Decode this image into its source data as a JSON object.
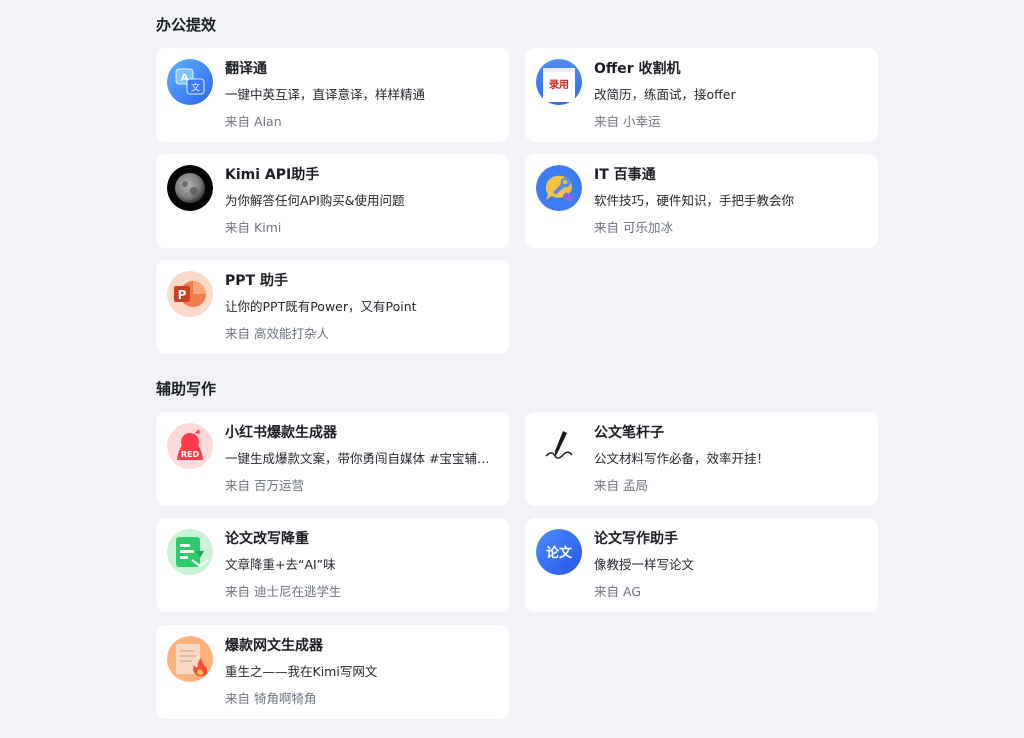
{
  "sections": [
    {
      "title": "办公提效",
      "cards": [
        {
          "name": "翻译通",
          "desc": "一键中英互译，直译意译，样样精通",
          "author": "Alan",
          "icon": "translate-icon"
        },
        {
          "name": "Offer 收割机",
          "desc": "改简历，练面试，接offer",
          "author": "小幸运",
          "icon": "offer-stamp-icon"
        },
        {
          "name": "Kimi API助手",
          "desc": "为你解答任何API购买&使用问题",
          "author": "Kimi",
          "icon": "moon-icon"
        },
        {
          "name": "IT 百事通",
          "desc": "软件技巧，硬件知识，手把手教会你",
          "author": "可乐加冰",
          "icon": "wrench-chat-icon"
        },
        {
          "name": "PPT 助手",
          "desc": "让你的PPT既有Power，又有Point",
          "author": "高效能打杂人",
          "icon": "powerpoint-icon"
        }
      ]
    },
    {
      "title": "辅助写作",
      "cards": [
        {
          "name": "小红书爆款生成器",
          "desc": "一键生成爆款文案，带你勇闯自媒体 #宝宝辅食 #敏感肌护肤",
          "author": "百万运营",
          "icon": "red-book-icon"
        },
        {
          "name": "公文笔杆子",
          "desc": "公文材料写作必备，效率开挂！",
          "author": "孟局",
          "icon": "pen-nib-icon"
        },
        {
          "name": "论文改写降重",
          "desc": "文章降重+去“AI”味",
          "author": "迪士尼在逃学生",
          "icon": "document-rewrite-icon"
        },
        {
          "name": "论文写作助手",
          "desc": "像教授一样写论文",
          "author": "AG",
          "icon": "thesis-icon"
        },
        {
          "name": "爆款网文生成器",
          "desc": "重生之——我在Kimi写网文",
          "author": "犄角啊犄角",
          "icon": "web-novel-icon"
        }
      ]
    }
  ],
  "author_prefix": "来自",
  "icon_texts": {
    "translate_a": "A",
    "translate_wen": "文",
    "offer_stamp": "录用",
    "ppt_letter": "P",
    "red_book": "RED",
    "thesis": "论文"
  },
  "colors": {
    "page_background": "#F1F3F9",
    "card_background": "#FFFFFF",
    "title_text": "#1A1D24",
    "author_text": "#6E7480"
  }
}
